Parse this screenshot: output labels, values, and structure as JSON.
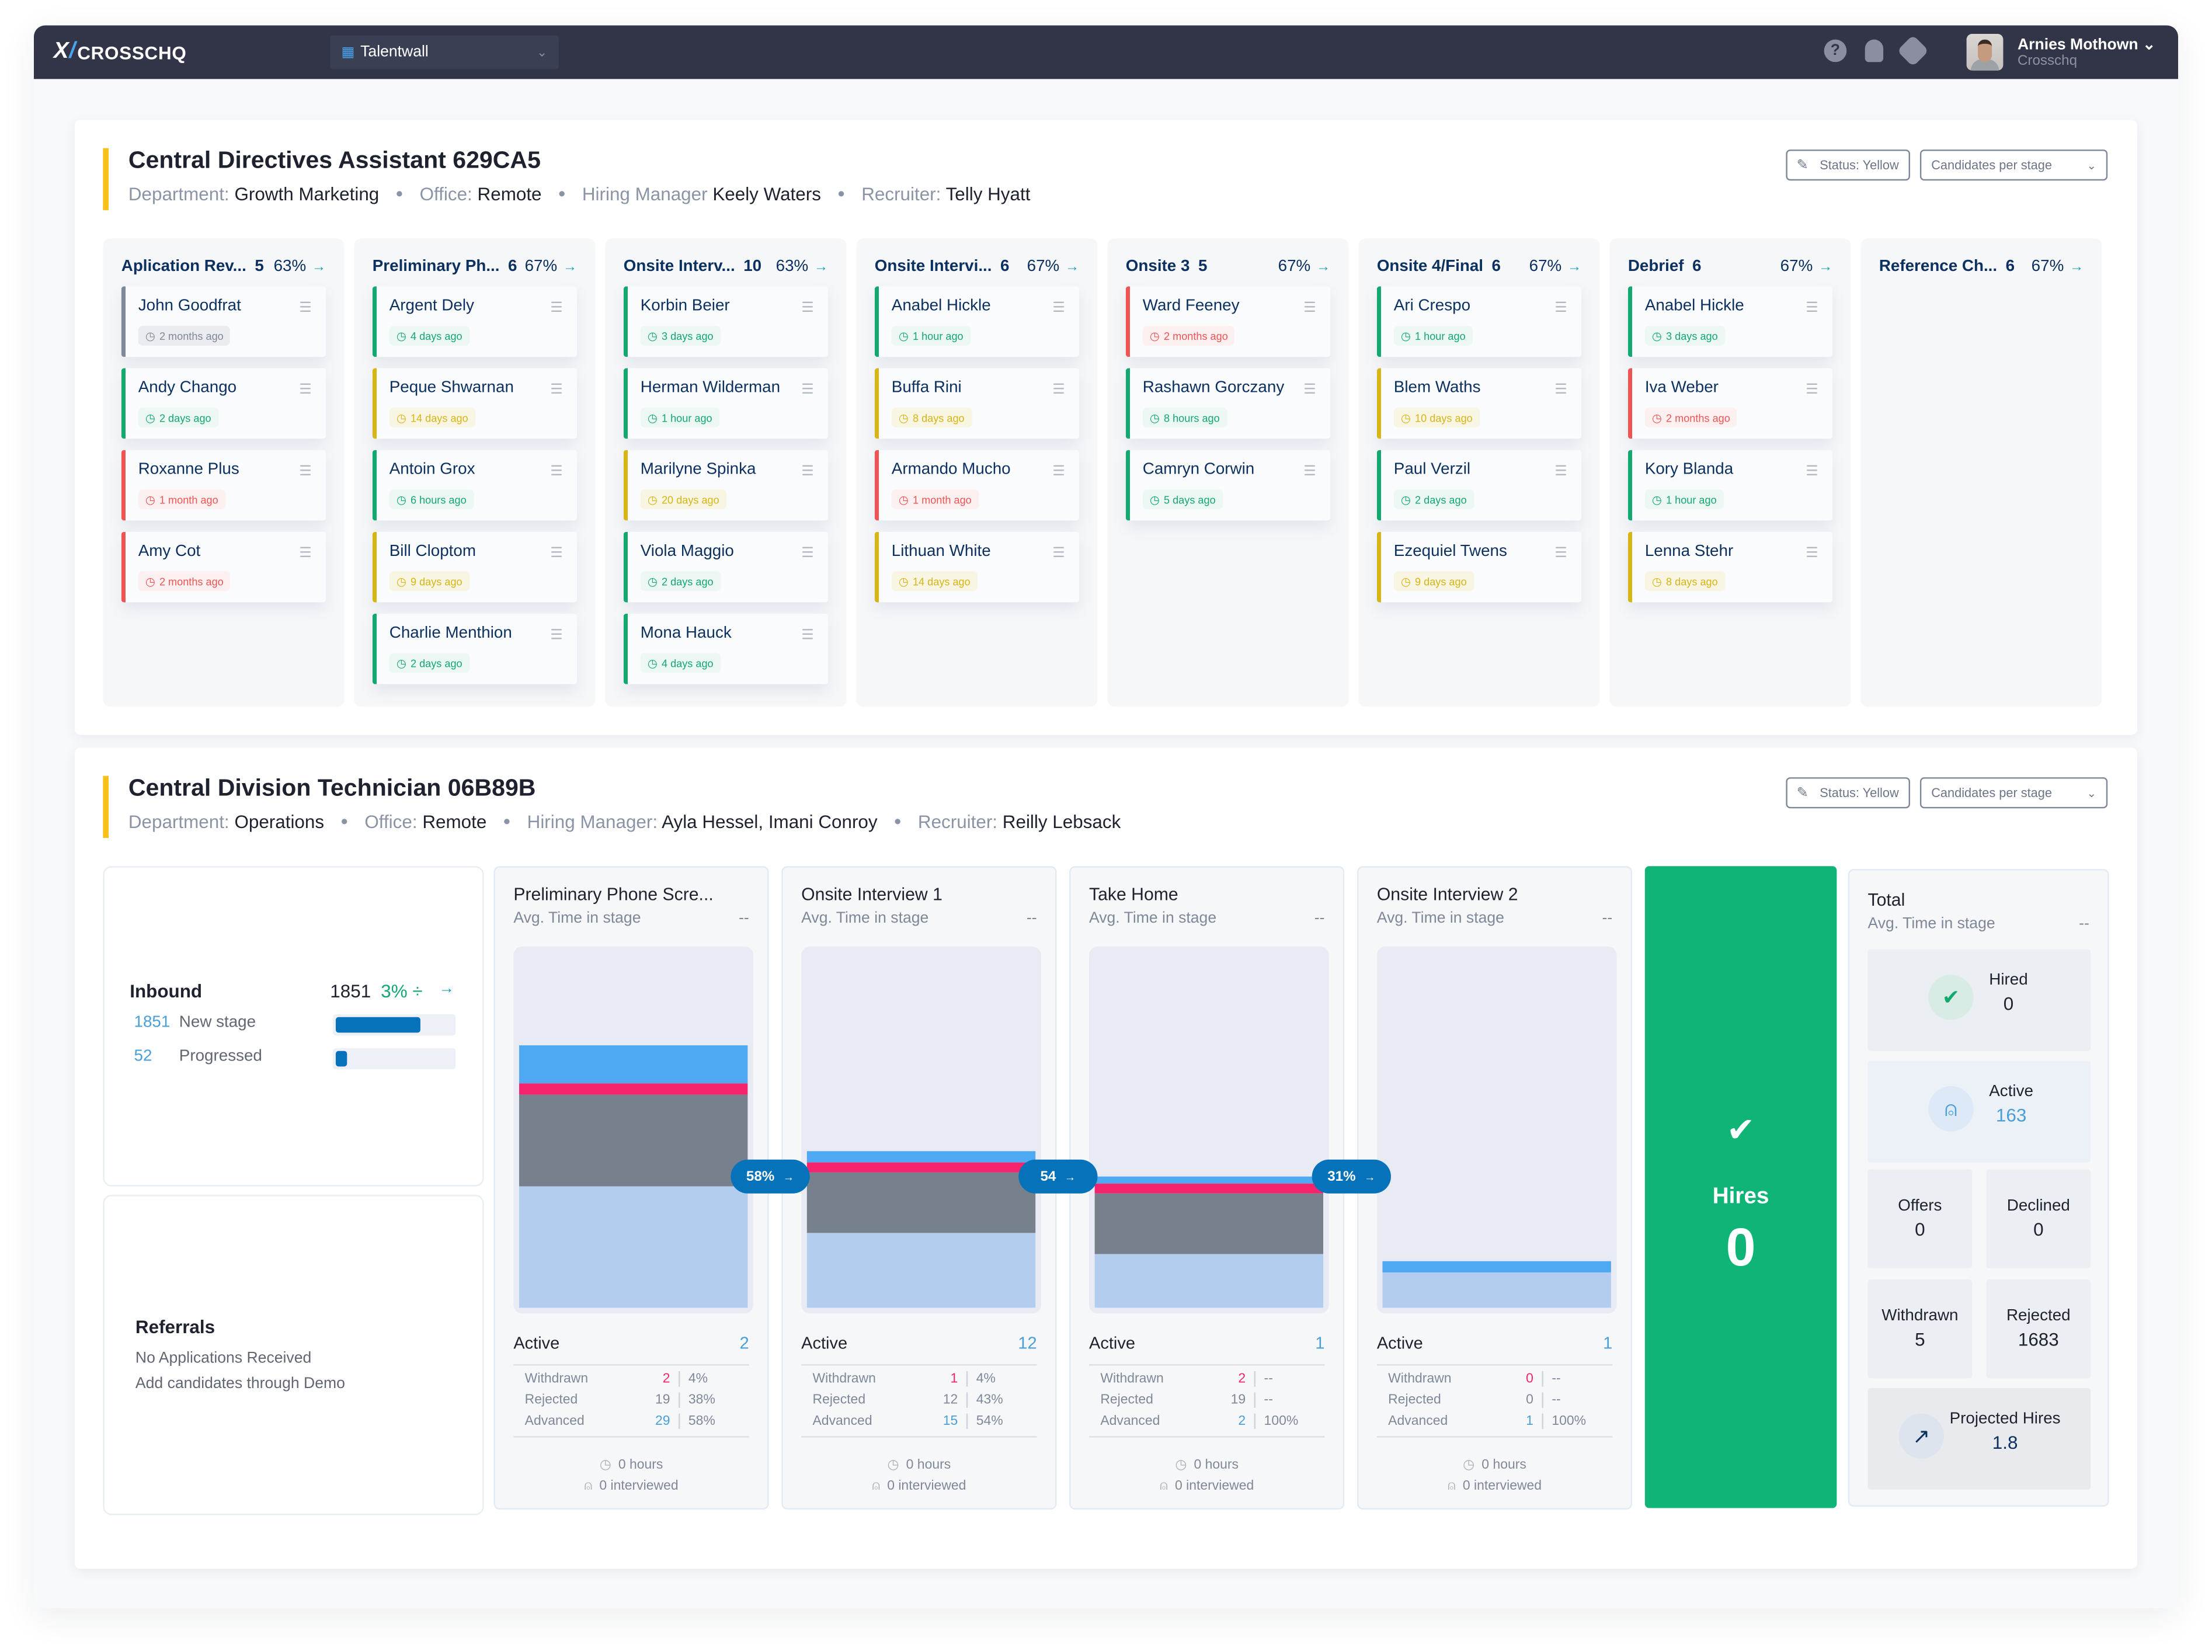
{
  "topbar": {
    "logo": "CROSSCHQ",
    "workspace": "Talentwall",
    "icons": [
      "help-icon",
      "bell-icon",
      "gear-icon"
    ],
    "user_name": "Arnies Mothown",
    "user_org": "Crosschq"
  },
  "job1": {
    "title": "Central Directives Assistant 629CA5",
    "meta": {
      "department_label": "Department:",
      "department": "Growth Marketing",
      "office_label": "Office:",
      "office": "Remote",
      "manager_label": "Hiring Manager",
      "manager": "Keely Waters",
      "recruiter_label": "Recruiter:",
      "recruiter": "Telly Hyatt"
    },
    "status_button": "Status: Yellow",
    "view_select": "Candidates per stage",
    "status_color": "#f7c11a",
    "columns": [
      {
        "name": "Aplication Rev...",
        "count": "5",
        "pct": "63%",
        "cards": [
          {
            "name": "John Goodfrat",
            "time": "2 months ago",
            "status": "gray"
          },
          {
            "name": "Andy Chango",
            "time": "2 days ago",
            "status": "green"
          },
          {
            "name": "Roxanne Plus",
            "time": "1 month ago",
            "status": "red"
          },
          {
            "name": "Amy Cot",
            "time": "2 months ago",
            "status": "red"
          }
        ]
      },
      {
        "name": "Preliminary Ph...",
        "count": "6",
        "pct": "67%",
        "cards": [
          {
            "name": "Argent Dely",
            "time": "4 days ago",
            "status": "green"
          },
          {
            "name": "Peque Shwarnan",
            "time": "14 days ago",
            "status": "yellow"
          },
          {
            "name": "Antoin Grox",
            "time": "6 hours ago",
            "status": "green"
          },
          {
            "name": "Bill Cloptom",
            "time": "9 days ago",
            "status": "yellow"
          },
          {
            "name": "Charlie Menthion",
            "time": "2 days ago",
            "status": "green"
          }
        ]
      },
      {
        "name": "Onsite Interv...",
        "count": "10",
        "pct": "63%",
        "cards": [
          {
            "name": "Korbin Beier",
            "time": "3 days ago",
            "status": "green"
          },
          {
            "name": "Herman Wilderman",
            "time": "1 hour ago",
            "status": "green"
          },
          {
            "name": "Marilyne Spinka",
            "time": "20 days ago",
            "status": "yellow"
          },
          {
            "name": "Viola Maggio",
            "time": "2 days ago",
            "status": "green"
          },
          {
            "name": "Mona Hauck",
            "time": "4 days ago",
            "status": "green"
          }
        ]
      },
      {
        "name": "Onsite Intervi...",
        "count": "6",
        "pct": "67%",
        "cards": [
          {
            "name": "Anabel Hickle",
            "time": "1 hour ago",
            "status": "green"
          },
          {
            "name": "Buffa Rini",
            "time": "8 days ago",
            "status": "yellow"
          },
          {
            "name": "Armando Mucho",
            "time": "1 month ago",
            "status": "red"
          },
          {
            "name": "Lithuan White",
            "time": "14 days ago",
            "status": "yellow"
          }
        ]
      },
      {
        "name": "Onsite 3",
        "count": "5",
        "pct": "67%",
        "cards": [
          {
            "name": "Ward Feeney",
            "time": "2 months ago",
            "status": "red"
          },
          {
            "name": "Rashawn Gorczany",
            "time": "8 hours ago",
            "status": "green"
          },
          {
            "name": "Camryn Corwin",
            "time": "5 days ago",
            "status": "green"
          }
        ]
      },
      {
        "name": "Onsite 4/Final",
        "count": "6",
        "pct": "67%",
        "cards": [
          {
            "name": "Ari Crespo",
            "time": "1 hour ago",
            "status": "green"
          },
          {
            "name": "Blem Waths",
            "time": "10 days ago",
            "status": "yellow"
          },
          {
            "name": "Paul Verzil",
            "time": "2 days ago",
            "status": "green"
          },
          {
            "name": "Ezequiel Twens",
            "time": "9 days ago",
            "status": "yellow"
          }
        ]
      },
      {
        "name": "Debrief",
        "count": "6",
        "pct": "67%",
        "cards": [
          {
            "name": "Anabel Hickle",
            "time": "3 days ago",
            "status": "green"
          },
          {
            "name": "Iva Weber",
            "time": "2 months ago",
            "status": "red"
          },
          {
            "name": "Kory Blanda",
            "time": "1 hour ago",
            "status": "green"
          },
          {
            "name": "Lenna Stehr",
            "time": "8 days ago",
            "status": "yellow"
          }
        ]
      },
      {
        "name": "Reference Ch...",
        "count": "6",
        "pct": "67%",
        "cards": []
      }
    ]
  },
  "job2": {
    "title": "Central Division Technician 06B89B",
    "meta": {
      "department_label": "Department:",
      "department": "Operations",
      "office_label": "Office:",
      "office": "Remote",
      "manager_label": "Hiring Manager:",
      "manager": "Ayla Hessel, Imani Conroy",
      "recruiter_label": "Recruiter:",
      "recruiter": "Reilly Lebsack"
    },
    "status_button": "Status: Yellow",
    "view_select": "Candidates per stage",
    "status_color": "#f7c11a",
    "inbound": {
      "title": "Inbound",
      "total": "1851",
      "pct": "3% ÷",
      "rows": [
        {
          "count": "1851",
          "label": "New stage",
          "fill": 0.72
        },
        {
          "count": "52",
          "label": "Progressed",
          "fill": 0.1
        }
      ]
    },
    "referrals": {
      "title": "Referrals",
      "line1": "No Applications Received",
      "line2": "Add candidates through Demo"
    },
    "stages": [
      {
        "name": "Preliminary Phone Scre...",
        "avg_label": "Avg. Time in stage",
        "avg": "--",
        "active_label": "Active",
        "active": "2",
        "rows": [
          {
            "label": "Withdrawn",
            "count": "2",
            "pct": "4%"
          },
          {
            "label": "Rejected",
            "count": "19",
            "pct": "38%"
          },
          {
            "label": "Advanced",
            "count": "29",
            "pct": "58%"
          }
        ],
        "hours": "0 hours",
        "interviewed": "0 interviewed",
        "bar": {
          "empty": 0.26,
          "active": 0.11,
          "withdrawn": 0.03,
          "rejected": 0.26,
          "advanced": 0.34
        }
      },
      {
        "name": "Onsite Interview 1",
        "avg_label": "Avg. Time in stage",
        "avg": "--",
        "active_label": "Active",
        "active": "12",
        "rows": [
          {
            "label": "Withdrawn",
            "count": "1",
            "pct": "4%"
          },
          {
            "label": "Rejected",
            "count": "12",
            "pct": "43%"
          },
          {
            "label": "Advanced",
            "count": "15",
            "pct": "54%"
          }
        ],
        "hours": "0 hours",
        "interviewed": "0 interviewed",
        "bar": {
          "empty": 0.56,
          "active": 0.03,
          "withdrawn": 0.03,
          "rejected": 0.17,
          "advanced": 0.21
        }
      },
      {
        "name": "Take Home",
        "avg_label": "Avg. Time in stage",
        "avg": "--",
        "active_label": "Active",
        "active": "1",
        "rows": [
          {
            "label": "Withdrawn",
            "count": "2",
            "pct": "--"
          },
          {
            "label": "Rejected",
            "count": "19",
            "pct": "--"
          },
          {
            "label": "Advanced",
            "count": "2",
            "pct": "100%"
          }
        ],
        "hours": "0 hours",
        "interviewed": "0 interviewed",
        "bar": {
          "empty": 0.63,
          "active": 0.02,
          "withdrawn": 0.03,
          "rejected": 0.17,
          "advanced": 0.15
        }
      },
      {
        "name": "Onsite Interview 2",
        "avg_label": "Avg. Time in stage",
        "avg": "--",
        "active_label": "Active",
        "active": "1",
        "rows": [
          {
            "label": "Withdrawn",
            "count": "0",
            "pct": "--"
          },
          {
            "label": "Rejected",
            "count": "0",
            "pct": "--"
          },
          {
            "label": "Advanced",
            "count": "1",
            "pct": "100%"
          }
        ],
        "hours": "0 hours",
        "interviewed": "0 interviewed",
        "bar": {
          "empty": 0.87,
          "active": 0.03,
          "withdrawn": 0,
          "rejected": 0,
          "advanced": 0.1
        }
      }
    ],
    "conversions": [
      "58%",
      "54",
      "31%"
    ],
    "hires": {
      "label": "Hires",
      "value": "0"
    },
    "total": {
      "title": "Total",
      "avg_label": "Avg. Time in stage",
      "avg": "--",
      "hired_label": "Hired",
      "hired": "0",
      "active_label": "Active",
      "active": "163",
      "offers_label": "Offers",
      "offers": "0",
      "declined_label": "Declined",
      "declined": "0",
      "withdrawn_label": "Withdrawn",
      "withdrawn": "5",
      "rejected_label": "Rejected",
      "rejected": "1683",
      "projected_label": "Projected Hires",
      "projected": "1.8"
    }
  }
}
